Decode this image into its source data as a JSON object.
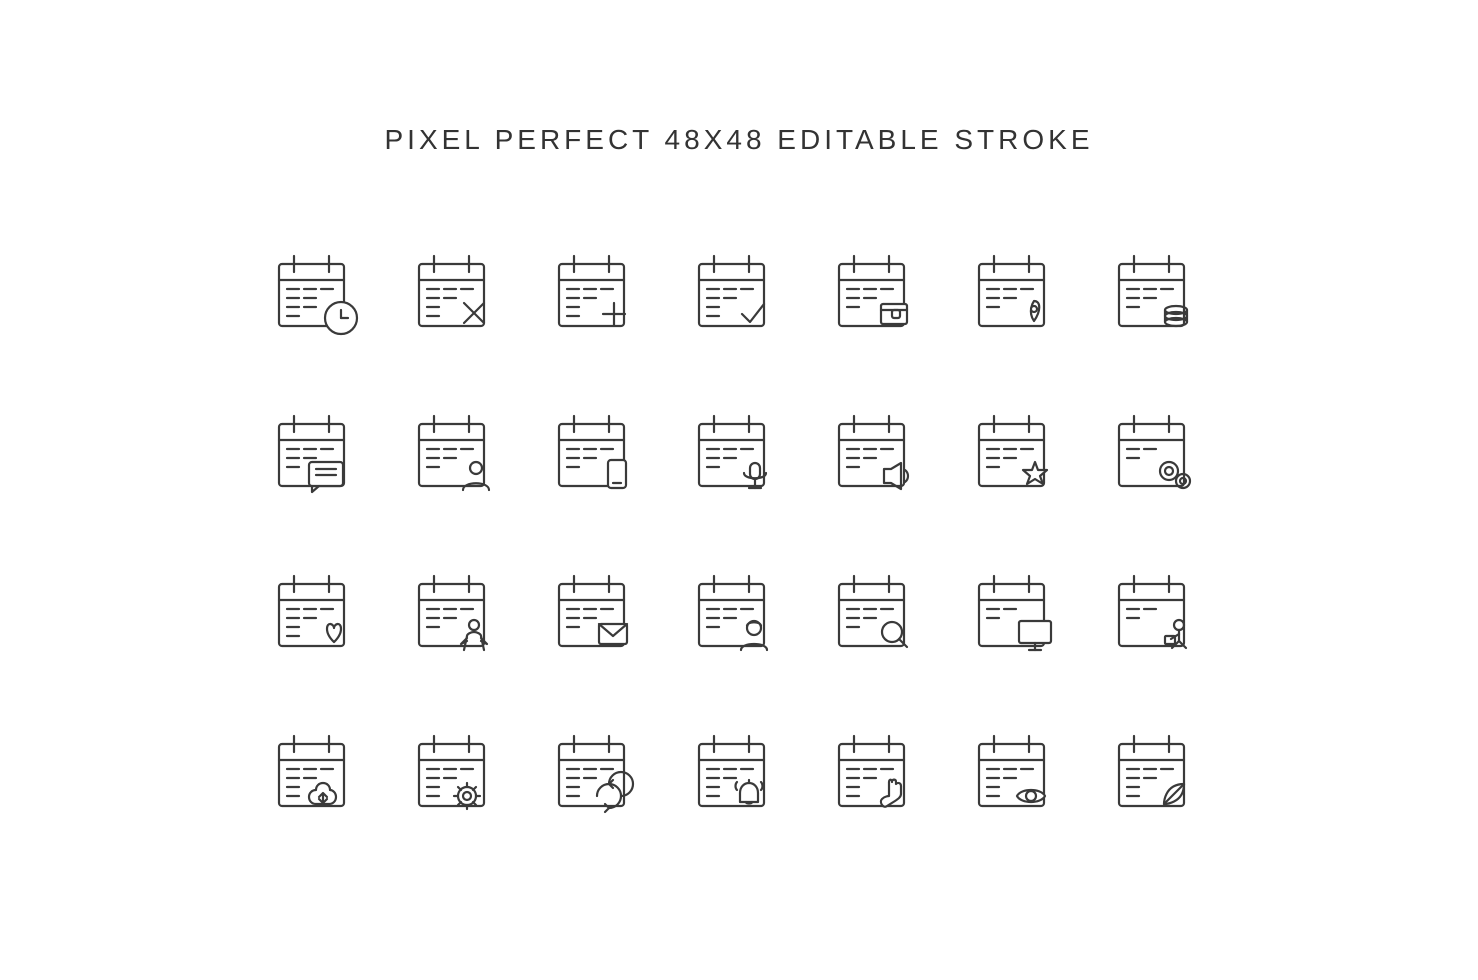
{
  "title": "PIXEL PERFECT 48x48 EDITABLE STROKE",
  "icons": [
    {
      "id": "calendar-clock",
      "label": "Calendar with clock"
    },
    {
      "id": "calendar-x",
      "label": "Calendar with X"
    },
    {
      "id": "calendar-plus",
      "label": "Calendar with plus"
    },
    {
      "id": "calendar-check",
      "label": "Calendar with checkmark"
    },
    {
      "id": "calendar-wallet",
      "label": "Calendar with wallet"
    },
    {
      "id": "calendar-location",
      "label": "Calendar with location pin"
    },
    {
      "id": "calendar-coins",
      "label": "Calendar with coins"
    },
    {
      "id": "calendar-message",
      "label": "Calendar with message"
    },
    {
      "id": "calendar-person",
      "label": "Calendar with person"
    },
    {
      "id": "calendar-phone",
      "label": "Calendar with phone"
    },
    {
      "id": "calendar-voice",
      "label": "Calendar with voice"
    },
    {
      "id": "calendar-speaker",
      "label": "Calendar with speaker"
    },
    {
      "id": "calendar-star",
      "label": "Calendar with star"
    },
    {
      "id": "calendar-settings",
      "label": "Calendar with settings"
    },
    {
      "id": "calendar-heart",
      "label": "Calendar with heart"
    },
    {
      "id": "calendar-book",
      "label": "Calendar with book"
    },
    {
      "id": "calendar-email",
      "label": "Calendar with email"
    },
    {
      "id": "calendar-user",
      "label": "Calendar with user"
    },
    {
      "id": "calendar-search",
      "label": "Calendar with search"
    },
    {
      "id": "calendar-monitor",
      "label": "Calendar with monitor"
    },
    {
      "id": "calendar-reading",
      "label": "Calendar with reading person"
    },
    {
      "id": "calendar-cloud",
      "label": "Calendar with cloud"
    },
    {
      "id": "calendar-gear",
      "label": "Calendar with gear"
    },
    {
      "id": "calendar-refresh",
      "label": "Calendar with refresh"
    },
    {
      "id": "calendar-bell",
      "label": "Calendar with bell"
    },
    {
      "id": "calendar-touch",
      "label": "Calendar with touch"
    },
    {
      "id": "calendar-eye",
      "label": "Calendar with eye"
    },
    {
      "id": "calendar-leaf",
      "label": "Calendar with leaf"
    }
  ]
}
